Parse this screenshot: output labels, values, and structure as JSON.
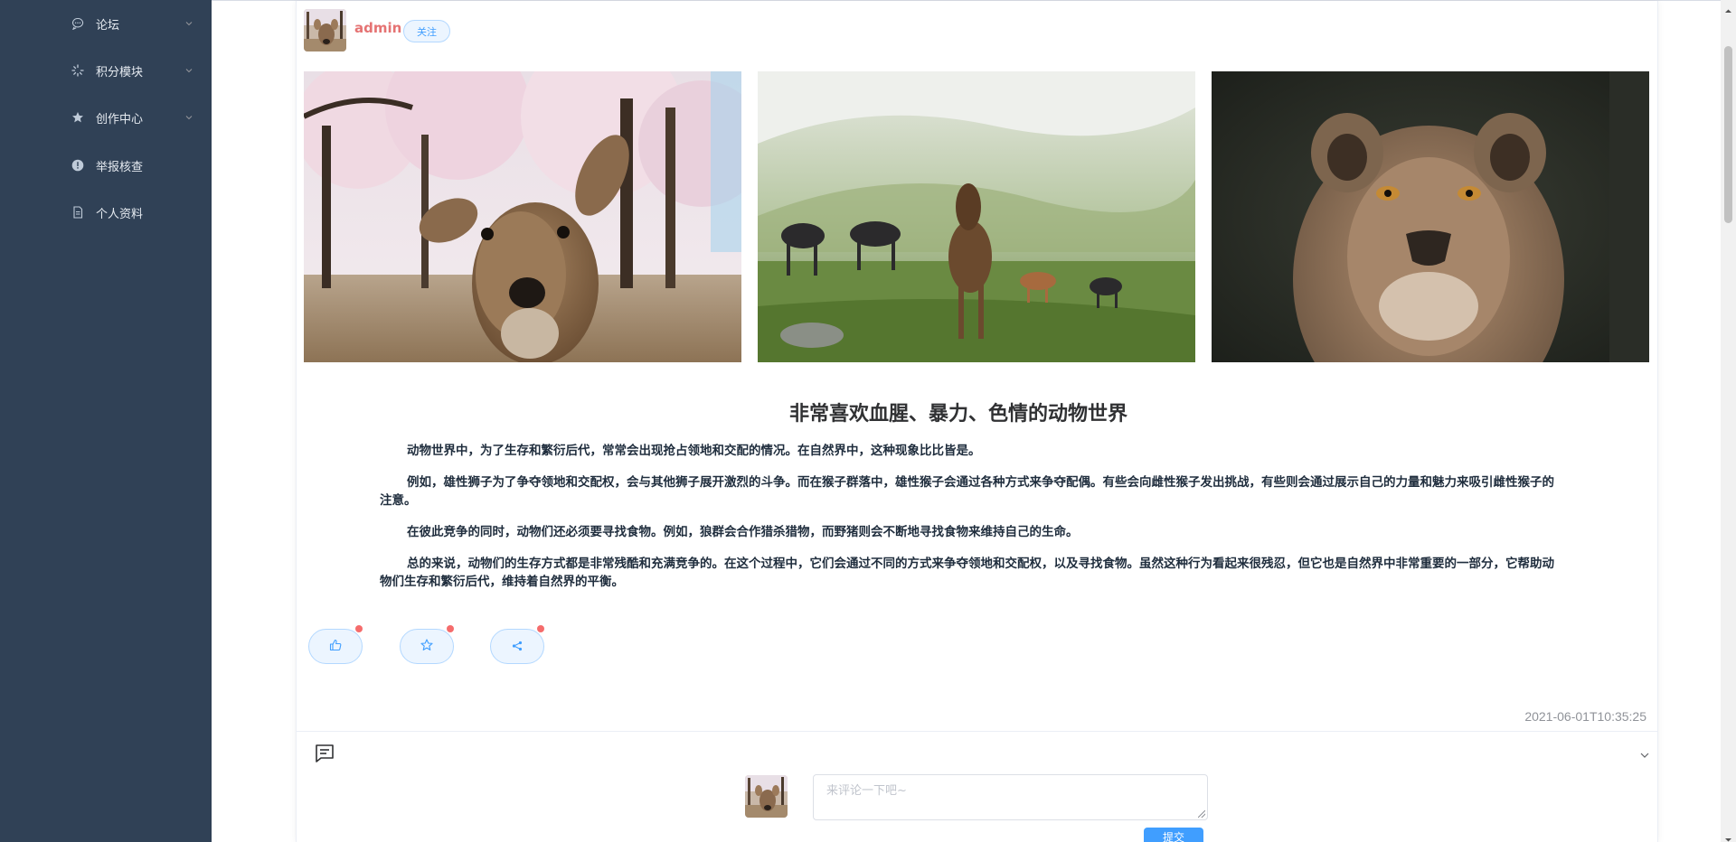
{
  "sidebar": {
    "items": [
      {
        "label": "论坛",
        "icon": "chat-bubble-icon"
      },
      {
        "label": "积分模块",
        "icon": "loading-spinner-icon"
      },
      {
        "label": "创作中心",
        "icon": "star-icon"
      },
      {
        "label": "举报核查",
        "icon": "warning-circle-icon"
      },
      {
        "label": "个人资料",
        "icon": "document-icon"
      }
    ]
  },
  "post": {
    "author": "admin",
    "follow_label": "关注",
    "title": "非常喜欢血腥、暴力、色情的动物世界",
    "paragraphs": [
      "动物世界中，为了生存和繁衍后代，常常会出现抢占领地和交配的情况。在自然界中，这种现象比比皆是。",
      "例如，雄性狮子为了争夺领地和交配权，会与其他狮子展开激烈的斗争。而在猴子群落中，雄性猴子会通过各种方式来争夺配偶。有些会向雌性猴子发出挑战，有些则会通过展示自己的力量和魅力来吸引雌性猴子的注意。",
      "在彼此竞争的同时，动物们还必须要寻找食物。例如，狼群会合作猎杀猎物，而野猪则会不断地寻找食物来维持自己的生命。",
      "总的来说，动物们的生存方式都是非常残酷和充满竞争的。在这个过程中，它们会通过不同的方式来争夺领地和交配权，以及寻找食物。虽然这种行为看起来很残忍，但它也是自然界中非常重要的一部分，它帮助动物们生存和繁衍后代，维持着自然界的平衡。"
    ],
    "timestamp": "2021-06-01T10:35:25",
    "images": [
      "deer-photo",
      "horses-photo",
      "lioness-photo"
    ]
  },
  "actions": {
    "like_icon": "thumbs-up-icon",
    "favorite_icon": "star-outline-icon",
    "share_icon": "share-icon"
  },
  "comments": {
    "placeholder": "来评论一下吧~",
    "submit_label": "提交"
  },
  "colors": {
    "sidebar_bg": "#304156",
    "author": "#e57373",
    "accent": "#409eff"
  }
}
